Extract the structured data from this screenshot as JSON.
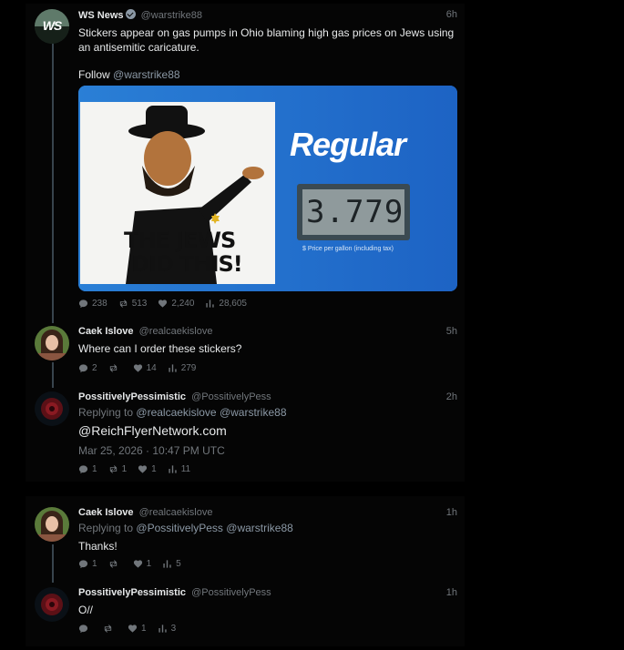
{
  "tweets": [
    {
      "name": "WS News",
      "handle": "@warstrike88",
      "time": "6h",
      "text": "Stickers appear on gas pumps in Ohio blaming high gas prices on Jews using an antisemitic caricature.",
      "follow_prefix": "Follow",
      "follow_link": "@warstrike88",
      "avatar_text": "WS",
      "media": {
        "sticker_text_1": "THE JEWS",
        "sticker_text_2": "DID THIS!",
        "pump_label": "Regular",
        "pump_price": "3.779",
        "pump_caption": "$ Price per gallon (including tax)"
      },
      "stats": {
        "replies": "238",
        "retweets": "513",
        "likes": "2,240",
        "views": "28,605"
      }
    },
    {
      "name": "Caek Islove",
      "handle": "@realcaekislove",
      "time": "5h",
      "text": "Where can I order these stickers?",
      "stats": {
        "replies": "2",
        "retweets": "",
        "likes": "14",
        "views": "279"
      }
    },
    {
      "name": "PossitivelyPessimistic",
      "handle": "@PossitivelyPess",
      "time": "2h",
      "replying_prefix": "Replying to",
      "replying_1": "@realcaekislove",
      "replying_2": "@warstrike88",
      "text": "@ReichFlyerNetwork.com",
      "date": "Mar 25, 2026 · 10:47 PM UTC",
      "stats": {
        "replies": "1",
        "retweets": "1",
        "likes": "1",
        "views": "11"
      }
    },
    {
      "name": "Caek Islove",
      "handle": "@realcaekislove",
      "time": "1h",
      "replying_prefix": "Replying to",
      "replying_1": "@PossitivelyPess",
      "replying_2": "@warstrike88",
      "text": "Thanks!",
      "stats": {
        "replies": "1",
        "retweets": "",
        "likes": "1",
        "views": "5"
      }
    },
    {
      "name": "PossitivelyPessimistic",
      "handle": "@PossitivelyPess",
      "time": "1h",
      "text": "O//",
      "stats": {
        "replies": "",
        "retweets": "",
        "likes": "1",
        "views": "3"
      }
    }
  ]
}
